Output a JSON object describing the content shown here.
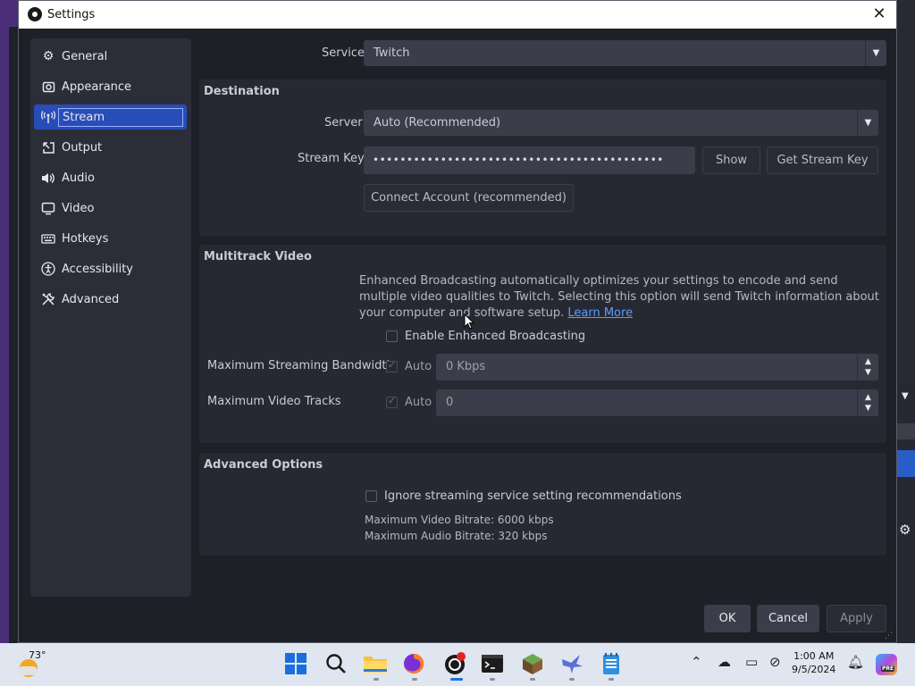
{
  "window": {
    "title": "Settings"
  },
  "sidebar": {
    "items": [
      {
        "label": "General",
        "icon": "gear-icon"
      },
      {
        "label": "Appearance",
        "icon": "appearance-icon"
      },
      {
        "label": "Stream",
        "icon": "antenna-icon"
      },
      {
        "label": "Output",
        "icon": "output-icon"
      },
      {
        "label": "Audio",
        "icon": "speaker-icon"
      },
      {
        "label": "Video",
        "icon": "monitor-icon"
      },
      {
        "label": "Hotkeys",
        "icon": "keyboard-icon"
      },
      {
        "label": "Accessibility",
        "icon": "accessibility-icon"
      },
      {
        "label": "Advanced",
        "icon": "wrench-icon"
      }
    ],
    "selected": "Stream"
  },
  "stream": {
    "service_label": "Service",
    "service_value": "Twitch",
    "destination": {
      "title": "Destination",
      "server_label": "Server",
      "server_value": "Auto (Recommended)",
      "stream_key_label": "Stream Key",
      "stream_key_value": "•••••••••••••••••••••••••••••••••••••••••••",
      "show_button": "Show",
      "get_key_button": "Get Stream Key",
      "connect_button": "Connect Account (recommended)"
    },
    "multitrack": {
      "title": "Multitrack Video",
      "description": "Enhanced Broadcasting automatically optimizes your settings to encode and send multiple video qualities to Twitch. Selecting this option will send Twitch information about your computer and software setup.",
      "learn_more": "Learn More",
      "enable_label": "Enable Enhanced Broadcasting",
      "enable_checked": false,
      "bandwidth_label": "Maximum Streaming Bandwidth",
      "bandwidth_auto_label": "Auto",
      "bandwidth_value": "0 Kbps",
      "tracks_label": "Maximum Video Tracks",
      "tracks_auto_label": "Auto",
      "tracks_value": "0"
    },
    "advanced": {
      "title": "Advanced Options",
      "ignore_label": "Ignore streaming service setting recommendations",
      "ignore_checked": false,
      "max_video_bitrate": "Maximum Video Bitrate: 6000 kbps",
      "max_audio_bitrate": "Maximum Audio Bitrate: 320 kbps"
    }
  },
  "footer": {
    "ok": "OK",
    "cancel": "Cancel",
    "apply": "Apply"
  },
  "taskbar": {
    "temperature": "73°",
    "time": "1:00 AM",
    "date": "9/5/2024",
    "badge": "PRE"
  },
  "colors": {
    "accent": "#284cb8",
    "dialog_bg": "#1e2027",
    "link": "#5a9bff"
  }
}
